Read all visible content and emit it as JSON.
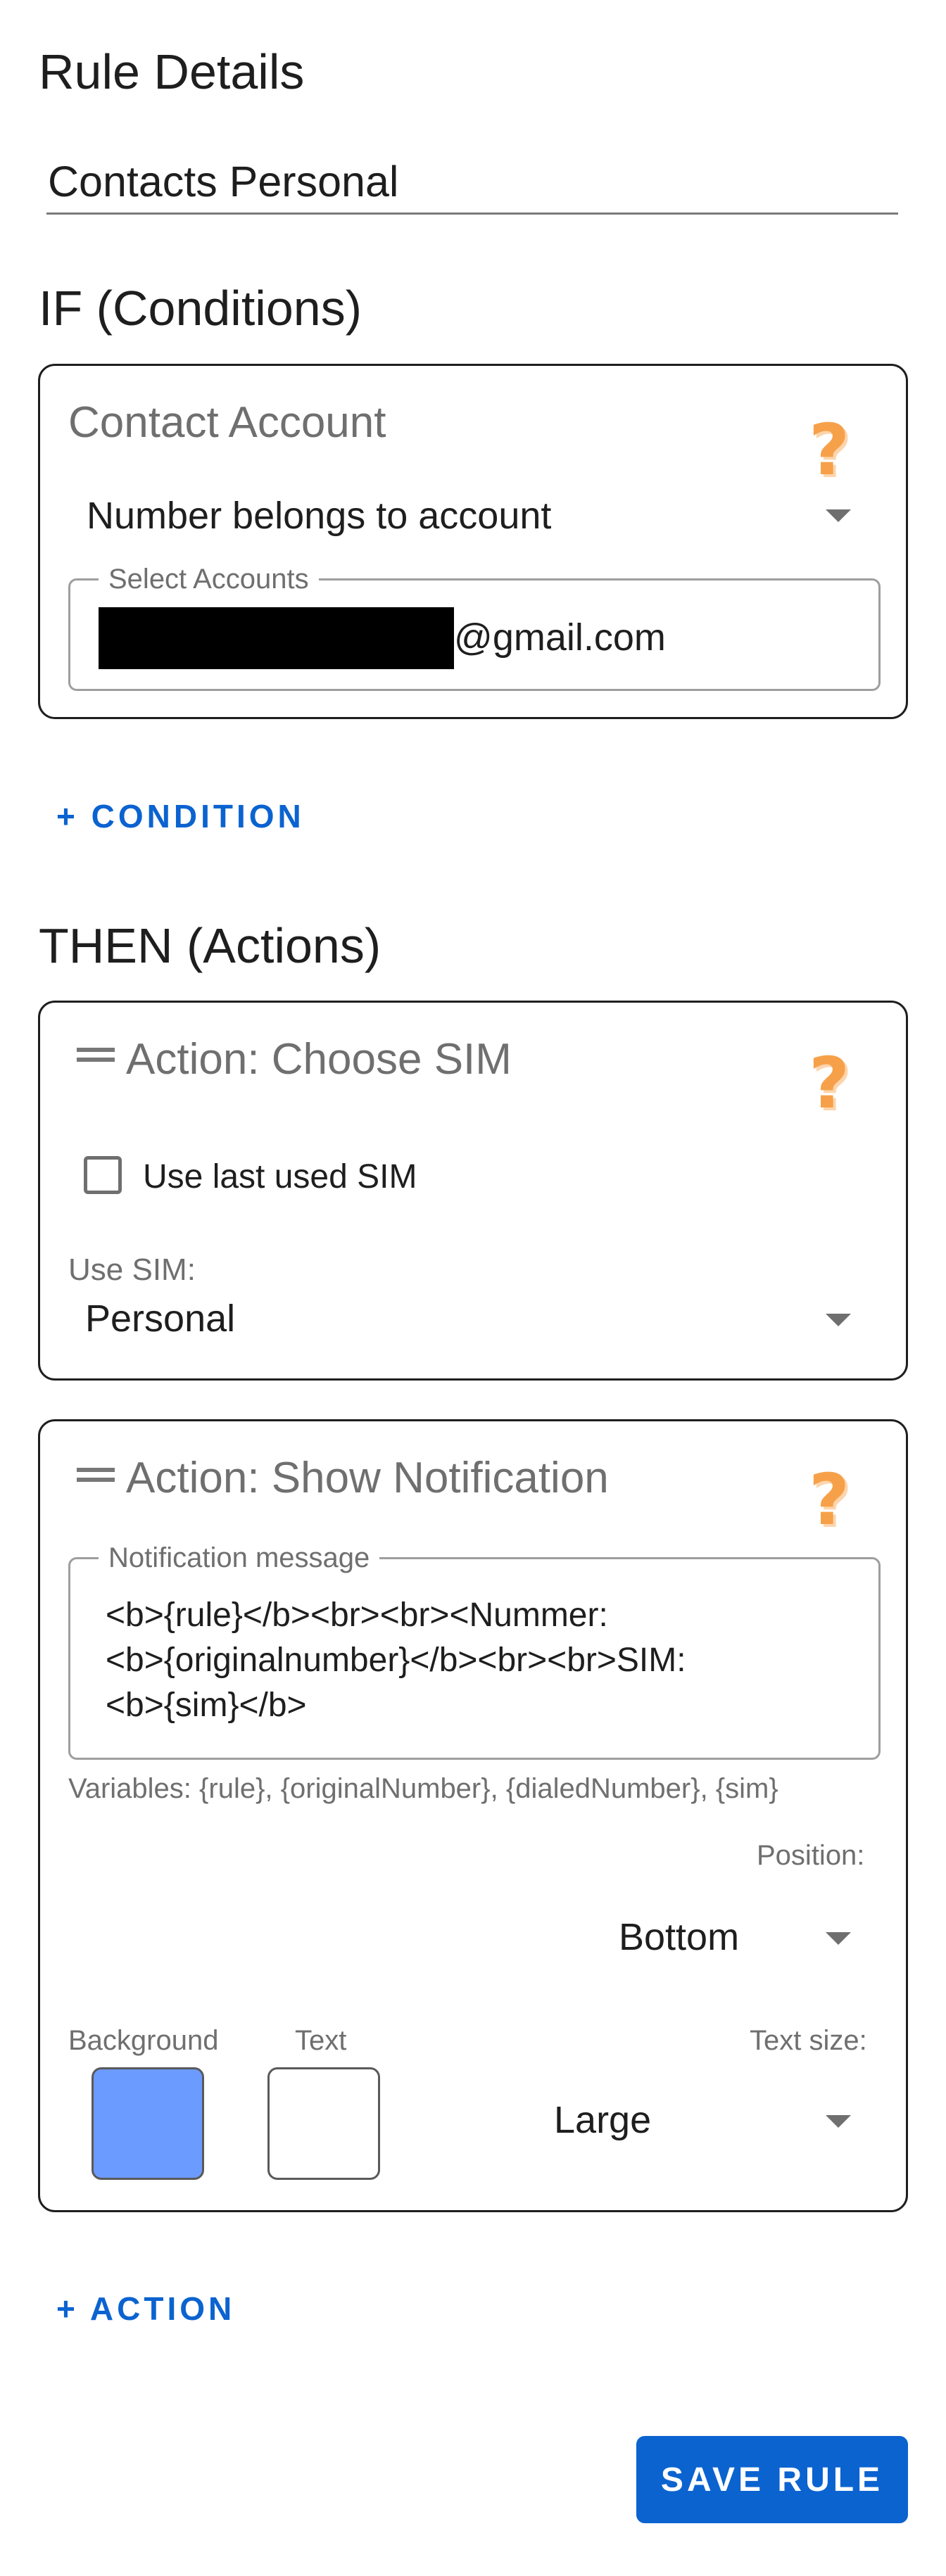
{
  "rule_details": {
    "heading": "Rule Details",
    "name_value": "Contacts Personal"
  },
  "conditions": {
    "heading": "IF (Conditions)",
    "contact_account": {
      "title": "Contact Account",
      "help_icon": "question-mark",
      "mode_value": "Number belongs to account",
      "accounts_label": "Select Accounts",
      "accounts_value_suffix": "@gmail.com"
    },
    "add_label": "+ CONDITION"
  },
  "actions": {
    "heading": "THEN (Actions)",
    "choose_sim": {
      "title": "Action: Choose SIM",
      "help_icon": "question-mark",
      "checkbox_label": "Use last used SIM",
      "checkbox_checked": false,
      "use_sim_label": "Use SIM:",
      "use_sim_value": "Personal"
    },
    "show_notification": {
      "title": "Action: Show Notification",
      "help_icon": "question-mark",
      "message_label": "Notification message",
      "message_lines": [
        "<b>{rule}</b><br><br><Nummer:",
        "<b>{originalnumber}</b><br><br>SIM:",
        "<b>{sim}</b>"
      ],
      "variables_hint": "Variables: {rule}, {originalNumber}, {dialedNumber}, {sim}",
      "position_label": "Position:",
      "position_value": "Bottom",
      "background_label": "Background",
      "background_color": "#6c9bff",
      "text_label": "Text",
      "text_color": "#ffffff",
      "text_size_label": "Text size:",
      "text_size_value": "Large"
    },
    "add_label": "+ ACTION"
  },
  "save_label": "SAVE RULE",
  "colors": {
    "accent": "#0b63d0",
    "help": "#f6a14a"
  }
}
